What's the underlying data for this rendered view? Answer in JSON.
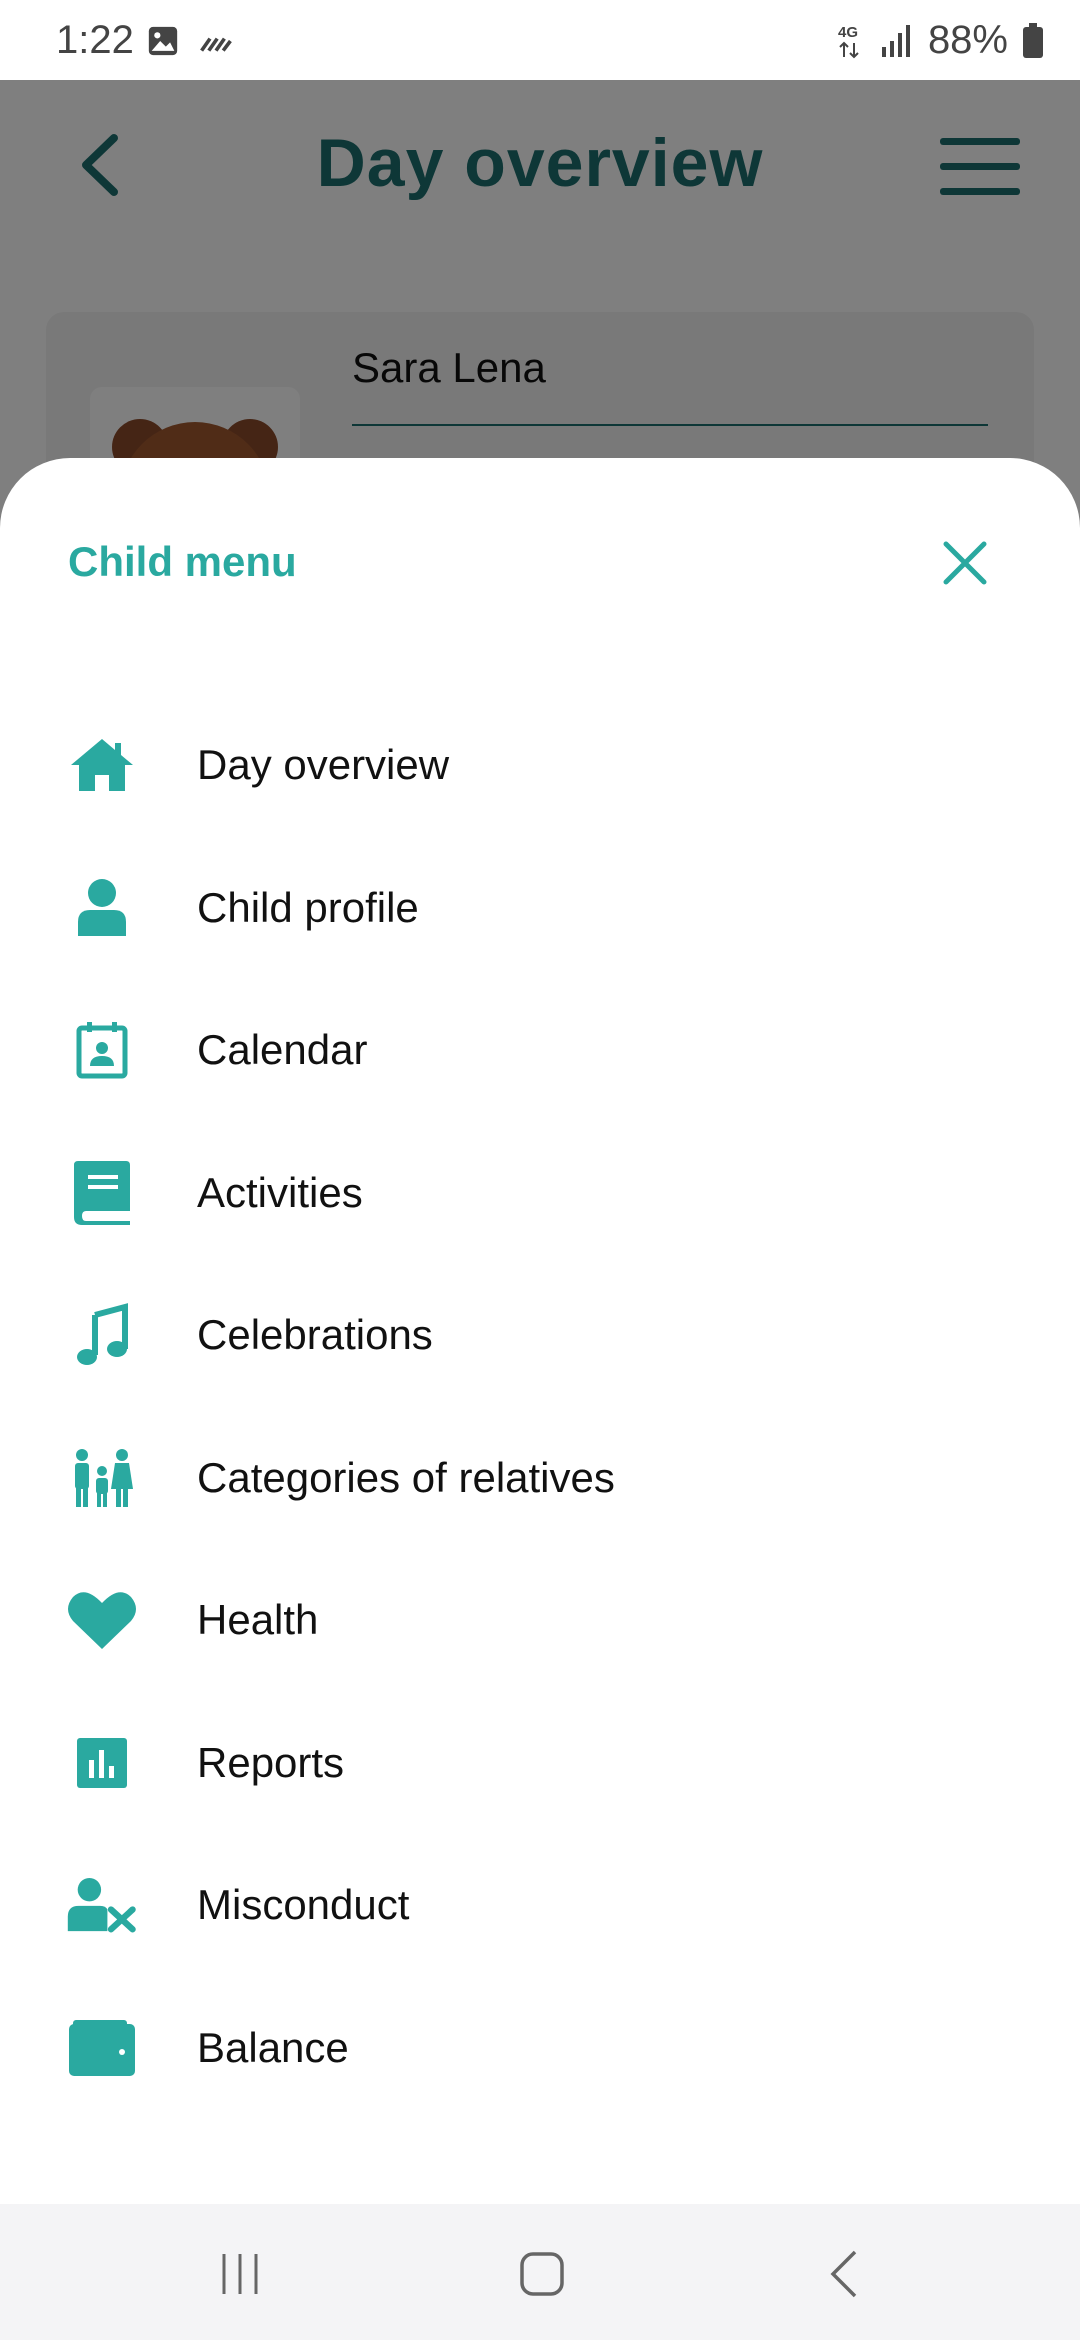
{
  "status_bar": {
    "time": "1:22",
    "network": "4G",
    "battery": "88%"
  },
  "header": {
    "title": "Day overview"
  },
  "profile": {
    "name": "Sara Lena"
  },
  "sheet": {
    "title": "Child menu",
    "items": [
      {
        "label": "Day overview",
        "icon": "home-icon"
      },
      {
        "label": "Child profile",
        "icon": "person-icon"
      },
      {
        "label": "Calendar",
        "icon": "calendar-icon"
      },
      {
        "label": "Activities",
        "icon": "book-icon"
      },
      {
        "label": "Celebrations",
        "icon": "music-note-icon"
      },
      {
        "label": "Categories of relatives",
        "icon": "family-icon"
      },
      {
        "label": "Health",
        "icon": "heart-icon"
      },
      {
        "label": "Reports",
        "icon": "bar-chart-icon"
      },
      {
        "label": "Misconduct",
        "icon": "person-x-icon"
      },
      {
        "label": "Balance",
        "icon": "wallet-icon"
      }
    ]
  },
  "colors": {
    "accent": "#2aa9a0",
    "title_dark": "#1c6e6e"
  }
}
